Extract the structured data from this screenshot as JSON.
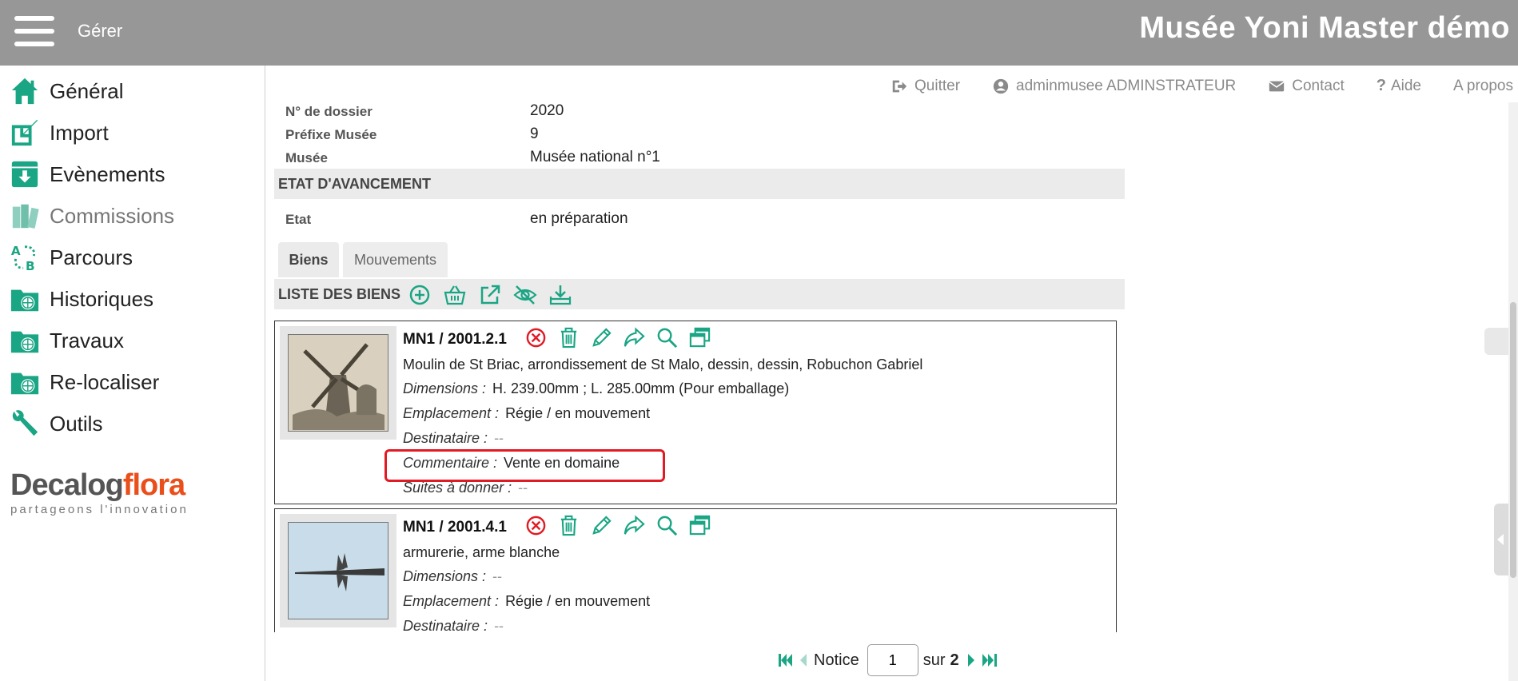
{
  "header": {
    "menu_label": "Gérer",
    "app_title": "Musée Yoni Master démo"
  },
  "sidebar": {
    "items": [
      {
        "label": "Général",
        "icon": "home-icon"
      },
      {
        "label": "Import",
        "icon": "import-icon"
      },
      {
        "label": "Evènements",
        "icon": "download-box-icon"
      },
      {
        "label": "Commissions",
        "icon": "books-icon"
      },
      {
        "label": "Parcours",
        "icon": "ab-route-icon"
      },
      {
        "label": "Historiques",
        "icon": "globe-folder-icon"
      },
      {
        "label": "Travaux",
        "icon": "globe-folder-icon"
      },
      {
        "label": "Re-localiser",
        "icon": "globe-folder-icon"
      },
      {
        "label": "Outils",
        "icon": "wrench-icon"
      }
    ],
    "logo": {
      "word1": "Decalog",
      "word2": "flora",
      "tagline": "partageons l'innovation"
    }
  },
  "toplinks": {
    "quit": "Quitter",
    "user": "adminmusee ADMINSTRATEUR",
    "contact": "Contact",
    "help": "Aide",
    "about": "A propos"
  },
  "dossier": {
    "fields": [
      {
        "label": "N° de dossier",
        "value": "2020"
      },
      {
        "label": "Préfixe Musée",
        "value": "9"
      },
      {
        "label": "Musée",
        "value": "Musée national n°1"
      }
    ],
    "progress_section": "ETAT D'AVANCEMENT",
    "state_label": "Etat",
    "state_value": "en préparation"
  },
  "tabs": {
    "biens": "Biens",
    "mouvements": "Mouvements"
  },
  "list": {
    "title": "LISTE DES BIENS",
    "items": [
      {
        "ref": "MN1 / 2001.2.1",
        "description": "Moulin de St Briac, arrondissement de St Malo, dessin, dessin, Robuchon Gabriel",
        "dimensions_label": "Dimensions :",
        "dimensions": "H. 239.00mm ; L. 285.00mm (Pour emballage)",
        "location_label": "Emplacement :",
        "location": "Régie / en mouvement",
        "recipient_label": "Destinataire :",
        "recipient": "--",
        "comment_label": "Commentaire :",
        "comment": "Vente en domaine",
        "followup_label": "Suites à donner :",
        "followup": "--"
      },
      {
        "ref": "MN1 / 2001.4.1",
        "description": "armurerie, arme blanche",
        "dimensions_label": "Dimensions :",
        "dimensions": "--",
        "location_label": "Emplacement :",
        "location": "Régie / en mouvement",
        "recipient_label": "Destinataire :",
        "recipient": "--"
      }
    ]
  },
  "pager": {
    "label": "Notice",
    "current": "1",
    "of": "sur",
    "total": "2"
  },
  "colors": {
    "header": "#979797",
    "accent": "#1aa584",
    "highlight": "#e01b24"
  }
}
